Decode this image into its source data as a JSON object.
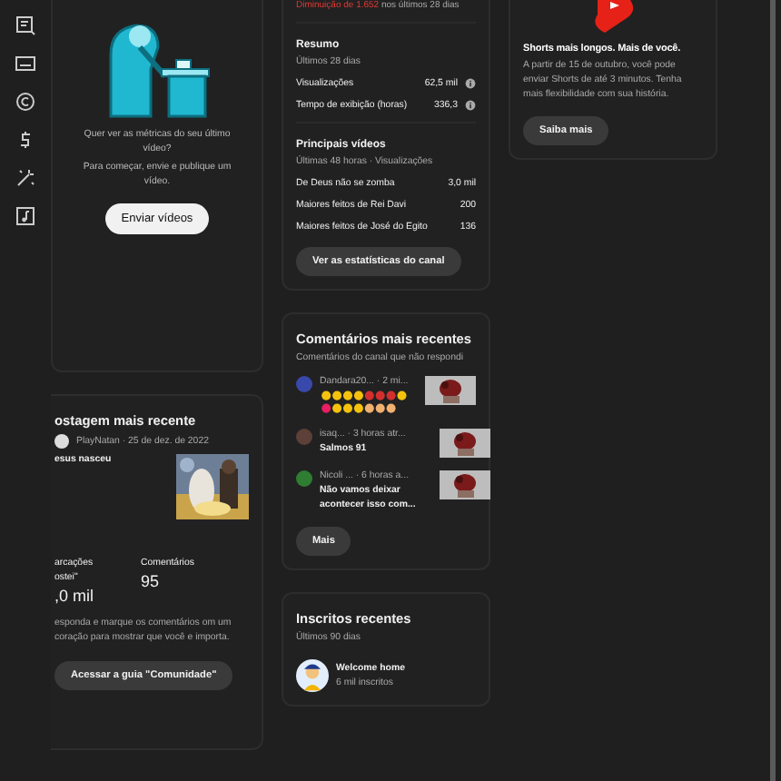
{
  "sidebar": {
    "items": [
      {
        "kind": "subtitles"
      },
      {
        "kind": "caption"
      },
      {
        "kind": "copyright"
      },
      {
        "kind": "money"
      },
      {
        "kind": "magic"
      },
      {
        "kind": "audio"
      }
    ]
  },
  "upload_card": {
    "prompt": "Quer ver as métricas do seu último vídeo?",
    "hint": "Para começar, envie e publique um vídeo.",
    "button": "Enviar vídeos"
  },
  "post_card": {
    "title": "ostagem mais recente",
    "meta": "PlayNatan · 25 de dez. de 2022",
    "text": "esus nasceu",
    "stats": [
      {
        "label": "arcações",
        "sublabel": "ostei\"",
        "value": ",0 mil"
      },
      {
        "label": "Comentários",
        "value": "95"
      }
    ],
    "note": "esponda e marque os comentários om um coração para mostrar que você e importa.",
    "button": "Acessar a guia \"Comunidade\""
  },
  "analytics_card": {
    "change": "**Diminuição de 1.652** nos últimos 28 dias",
    "summary": {
      "title": "Resumo",
      "period": "Últimos 28 dias",
      "rows": [
        {
          "label": "Visualizações",
          "value": "62,5 mil"
        },
        {
          "label": "Tempo de exibição (horas)",
          "value": "336,3"
        }
      ]
    },
    "top_videos": {
      "title": "Principais vídeos",
      "period": "Últimas 48 horas · Visualizações",
      "rows": [
        {
          "label": "De Deus não se zomba",
          "value": "3,0 mil"
        },
        {
          "label": "Maiores feitos de Rei Davi",
          "value": "200"
        },
        {
          "label": "Maiores feitos de José do Egito",
          "value": "136"
        }
      ]
    },
    "button": "Ver as estatísticas do canal"
  },
  "comments_card": {
    "title": "Comentários mais recentes",
    "subtitle": "Comentários do canal que não respondi",
    "comments": [
      {
        "meta": "Dandara20... · 2 mi...",
        "kind": "emoji",
        "color": "#3949ab"
      },
      {
        "meta": "isaq... · 3 horas atr...",
        "text": "Salmos 91",
        "kind": "text",
        "color": "#5d4037"
      },
      {
        "meta": "Nicoli ... · 6 horas a...",
        "text": "Não vamos deixar acontecer isso com...",
        "kind": "text",
        "color": "#2e7d32"
      }
    ],
    "button": "Mais"
  },
  "subscribers_card": {
    "title": "Inscritos recentes",
    "period": "Últimos 90 dias",
    "items": [
      {
        "name": "Welcome home",
        "count": "6 mil inscritos"
      }
    ]
  },
  "shorts_card": {
    "title": "Shorts mais longos. Mais de você.",
    "text": "A partir de 15 de outubro, você pode enviar Shorts de até 3 minutos. Tenha mais flexibilidade com sua história.",
    "button": "Saiba mais"
  }
}
